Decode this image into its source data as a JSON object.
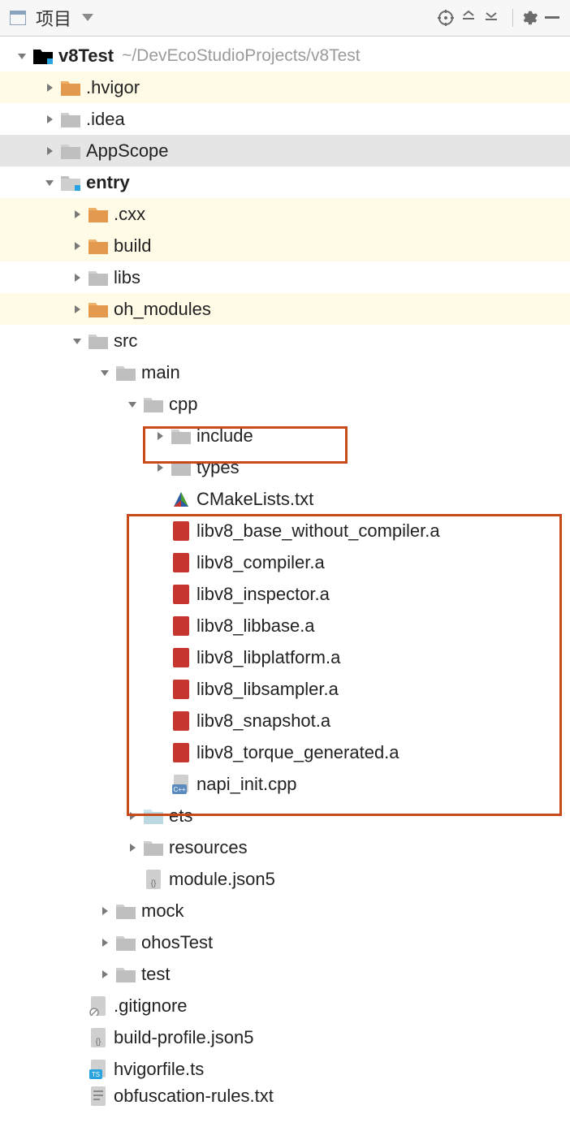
{
  "toolbar": {
    "title": "项目"
  },
  "tree": {
    "root": {
      "name": "v8Test",
      "path": "~/DevEcoStudioProjects/v8Test"
    },
    "hvigor": ".hvigor",
    "idea": ".idea",
    "appscope": "AppScope",
    "entry": "entry",
    "cxx": ".cxx",
    "build": "build",
    "libs": "libs",
    "oh_modules": "oh_modules",
    "src": "src",
    "main": "main",
    "cpp": "cpp",
    "include": "include",
    "types": "types",
    "cmakelists": "CMakeLists.txt",
    "files_a": [
      "libv8_base_without_compiler.a",
      "libv8_compiler.a",
      "libv8_inspector.a",
      "libv8_libbase.a",
      "libv8_libplatform.a",
      "libv8_libsampler.a",
      "libv8_snapshot.a",
      "libv8_torque_generated.a"
    ],
    "napi": "napi_init.cpp",
    "ets": "ets",
    "resources": "resources",
    "module_json5": "module.json5",
    "mock": "mock",
    "ohostest": "ohosTest",
    "test": "test",
    "gitignore": ".gitignore",
    "build_profile": "build-profile.json5",
    "hvigorfile": "hvigorfile.ts",
    "obfuscation": "obfuscation-rules.txt"
  }
}
